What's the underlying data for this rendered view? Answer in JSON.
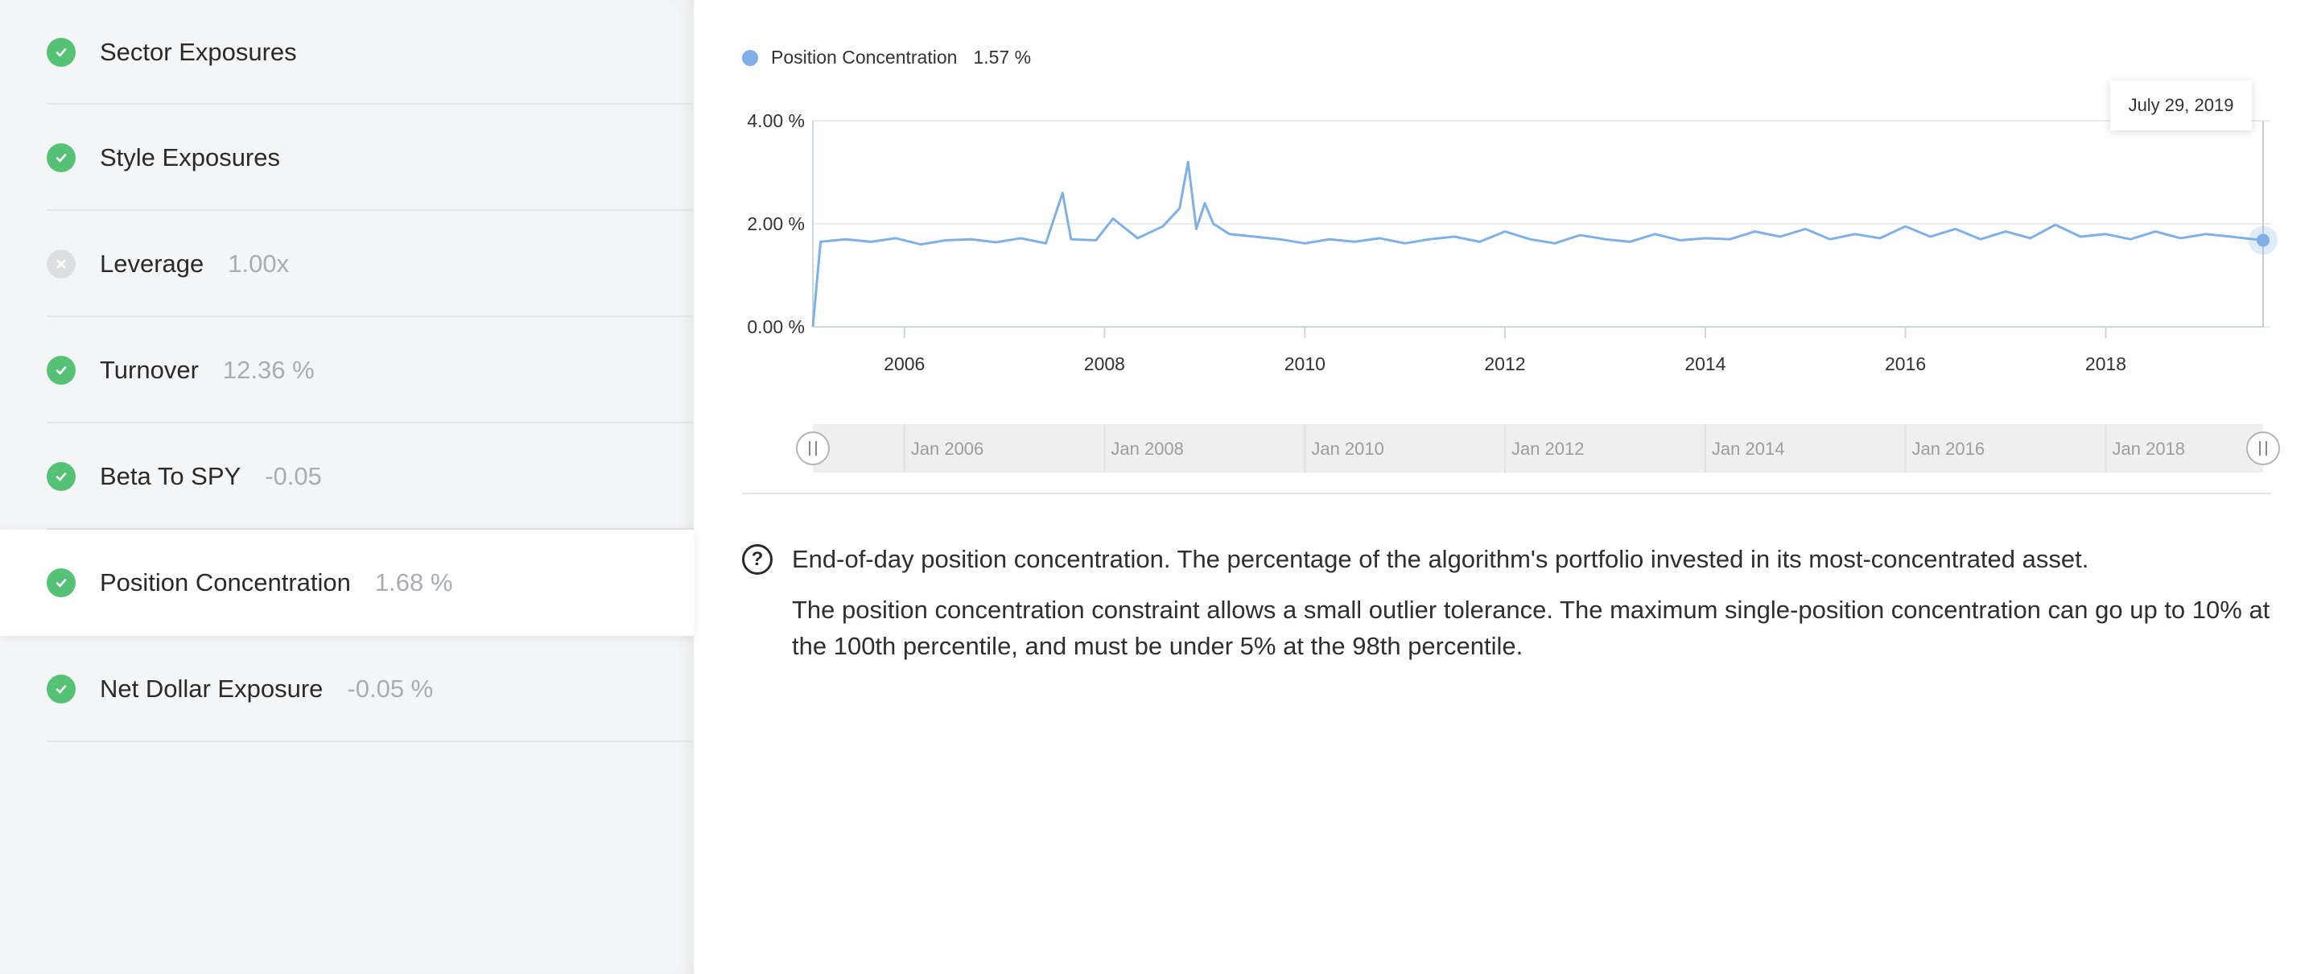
{
  "sidebar": {
    "items": [
      {
        "name": "Sector Exposures",
        "value": "",
        "status": "pass"
      },
      {
        "name": "Style Exposures",
        "value": "",
        "status": "pass"
      },
      {
        "name": "Leverage",
        "value": "1.00x",
        "status": "neutral"
      },
      {
        "name": "Turnover",
        "value": "12.36 %",
        "status": "pass"
      },
      {
        "name": "Beta To SPY",
        "value": "-0.05",
        "status": "pass"
      },
      {
        "name": "Position Concentration",
        "value": "1.68 %",
        "status": "pass",
        "active": true
      },
      {
        "name": "Net Dollar Exposure",
        "value": "-0.05 %",
        "status": "pass"
      }
    ]
  },
  "legend": {
    "name": "Position Concentration",
    "value": "1.57 %"
  },
  "tooltip": {
    "date": "July 29, 2019"
  },
  "description": {
    "line1": "End-of-day position concentration. The percentage of the algorithm's portfolio invested in its most-concentrated asset.",
    "line2": "The position concentration constraint allows a small outlier tolerance. The maximum single-position concentration can go up to 10% at the 100th percentile, and must be under 5% at the 98th percentile."
  },
  "colors": {
    "series": "#7fb0e6",
    "pass": "#55c275",
    "neutral": "#dcdee0",
    "muted_text": "#a9adb1"
  },
  "icons": {
    "pass": "check-icon",
    "neutral": "x-icon",
    "help": "question-circle-icon"
  },
  "chart_data": {
    "type": "line",
    "title": "",
    "xlabel": "",
    "ylabel": "",
    "ylim": [
      0,
      4
    ],
    "y_ticks": [
      "0.00 %",
      "2.00 %",
      "4.00 %"
    ],
    "x_ticks": [
      "2006",
      "2008",
      "2010",
      "2012",
      "2014",
      "2016",
      "2018"
    ],
    "navigator_ticks": [
      "Jan 2006",
      "Jan 2008",
      "Jan 2010",
      "Jan 2012",
      "Jan 2014",
      "Jan 2016",
      "Jan 2018"
    ],
    "x_range": [
      "2005-02",
      "2019-07-29"
    ],
    "series": [
      {
        "name": "Position Concentration",
        "x": [
          "2005-02",
          "2005-03",
          "2005-06",
          "2005-09",
          "2005-12",
          "2006-03",
          "2006-06",
          "2006-09",
          "2006-12",
          "2007-03",
          "2007-06",
          "2007-08",
          "2007-09",
          "2007-12",
          "2008-02",
          "2008-05",
          "2008-08",
          "2008-10",
          "2008-11",
          "2008-12",
          "2009-01",
          "2009-02",
          "2009-04",
          "2009-07",
          "2009-10",
          "2010-01",
          "2010-04",
          "2010-07",
          "2010-10",
          "2011-01",
          "2011-04",
          "2011-07",
          "2011-10",
          "2012-01",
          "2012-04",
          "2012-07",
          "2012-10",
          "2013-01",
          "2013-04",
          "2013-07",
          "2013-10",
          "2014-01",
          "2014-04",
          "2014-07",
          "2014-10",
          "2015-01",
          "2015-04",
          "2015-07",
          "2015-10",
          "2016-01",
          "2016-04",
          "2016-07",
          "2016-10",
          "2017-01",
          "2017-04",
          "2017-07",
          "2017-10",
          "2018-01",
          "2018-04",
          "2018-07",
          "2018-10",
          "2019-01",
          "2019-04",
          "2019-07-29"
        ],
        "y": [
          0.0,
          1.65,
          1.7,
          1.65,
          1.72,
          1.6,
          1.68,
          1.7,
          1.64,
          1.72,
          1.62,
          2.6,
          1.7,
          1.68,
          2.1,
          1.72,
          1.95,
          2.3,
          3.2,
          1.9,
          2.4,
          2.0,
          1.8,
          1.75,
          1.7,
          1.62,
          1.7,
          1.65,
          1.72,
          1.62,
          1.7,
          1.75,
          1.65,
          1.85,
          1.7,
          1.62,
          1.78,
          1.7,
          1.65,
          1.8,
          1.68,
          1.72,
          1.7,
          1.85,
          1.75,
          1.9,
          1.7,
          1.8,
          1.72,
          1.95,
          1.75,
          1.9,
          1.7,
          1.85,
          1.72,
          1.98,
          1.75,
          1.8,
          1.7,
          1.85,
          1.72,
          1.8,
          1.75,
          1.68
        ]
      }
    ]
  }
}
